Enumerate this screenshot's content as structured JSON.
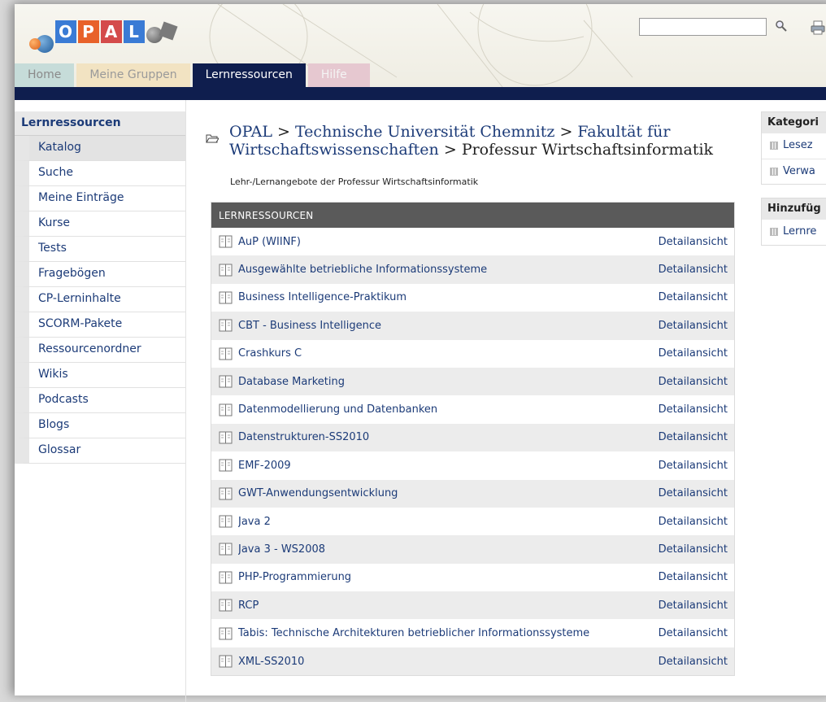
{
  "logo": {
    "letters": [
      "O",
      "P",
      "A",
      "L"
    ]
  },
  "search": {
    "value": "",
    "placeholder": ""
  },
  "nav": {
    "tabs": [
      {
        "label": "Home"
      },
      {
        "label": "Meine Gruppen"
      },
      {
        "label": "Lernressourcen"
      },
      {
        "label": "Hilfe"
      }
    ],
    "active": "Lernressourcen"
  },
  "sidebar": {
    "title": "Lernressourcen",
    "items": [
      {
        "label": "Katalog"
      },
      {
        "label": "Suche"
      },
      {
        "label": "Meine Einträge"
      },
      {
        "label": "Kurse"
      },
      {
        "label": "Tests"
      },
      {
        "label": "Fragebögen"
      },
      {
        "label": "CP-Lerninhalte"
      },
      {
        "label": "SCORM-Pakete"
      },
      {
        "label": "Ressourcenordner"
      },
      {
        "label": "Wikis"
      },
      {
        "label": "Podcasts"
      },
      {
        "label": "Blogs"
      },
      {
        "label": "Glossar"
      }
    ]
  },
  "breadcrumb": {
    "parts": [
      "OPAL",
      "Technische Universität Chemnitz",
      "Fakultät für",
      "Wirtschaftswissenschaften",
      "Professur Wirtschaftsinformatik"
    ],
    "separator": ">"
  },
  "subtitle": "Lehr-/Lernangebote der Professur Wirtschaftsinformatik",
  "table": {
    "header": "LERNRESSOURCEN",
    "detail_label": "Detailansicht",
    "rows": [
      {
        "title": "AuP (WIINF)"
      },
      {
        "title": "Ausgewählte betriebliche Informationssysteme"
      },
      {
        "title": "Business Intelligence-Praktikum"
      },
      {
        "title": "CBT - Business Intelligence"
      },
      {
        "title": "Crashkurs C"
      },
      {
        "title": "Database Marketing"
      },
      {
        "title": "Datenmodellierung und Datenbanken"
      },
      {
        "title": "Datenstrukturen-SS2010"
      },
      {
        "title": "EMF-2009"
      },
      {
        "title": "GWT-Anwendungsentwicklung"
      },
      {
        "title": "Java 2"
      },
      {
        "title": "Java 3 - WS2008"
      },
      {
        "title": "PHP-Programmierung"
      },
      {
        "title": "RCP"
      },
      {
        "title": "Tabis: Technische Architekturen betrieblicher Informationssysteme"
      },
      {
        "title": "XML-SS2010"
      }
    ]
  },
  "right": {
    "boxes": [
      {
        "title": "Kategori",
        "items": [
          {
            "label": "Lesez"
          },
          {
            "label": "Verwa"
          }
        ]
      },
      {
        "title": "Hinzufüg",
        "items": [
          {
            "label": "Lernre"
          }
        ]
      }
    ]
  },
  "colors": {
    "nav_dark": "#0f1e4e",
    "link": "#1c3b78",
    "table_header": "#5a5a5a"
  },
  "icons": {
    "search": "magnifier-icon",
    "print": "printer-icon",
    "folder": "folder-open-icon",
    "resource": "book-icon",
    "bullet": "grid-bullet-icon"
  }
}
